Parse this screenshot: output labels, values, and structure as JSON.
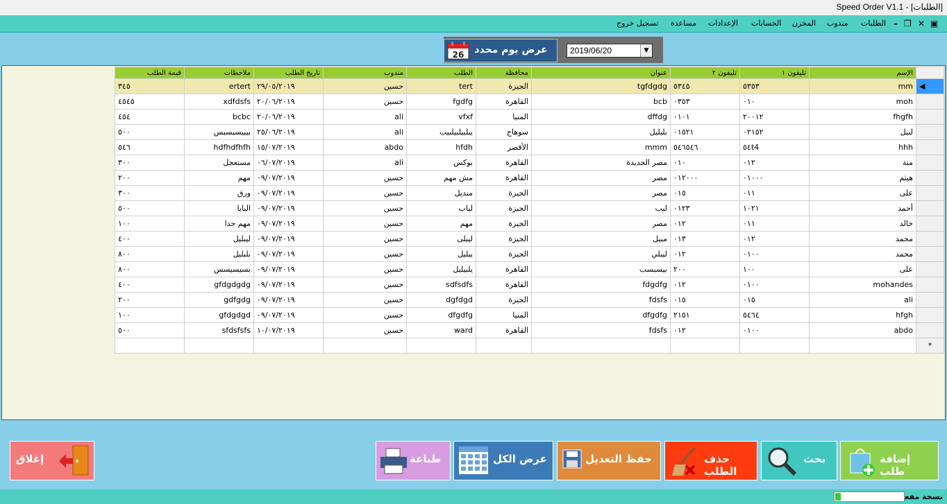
{
  "window": {
    "title": "Speed Order V1.1 - [الطلبات]"
  },
  "menu": [
    "الطلبات",
    "مندوب",
    "المخزن",
    "الحسابات",
    "الإعدادات",
    "مساعدة",
    "تسجيل خروج"
  ],
  "toolbar": {
    "show_day_label": "عرض يوم محدد",
    "calendar_badge": "26",
    "date_value": "2019/06/20"
  },
  "grid": {
    "columns": [
      "الإسم",
      "تليفون ١",
      "تليفون ٢",
      "عنوان",
      "محافظة",
      "الطلب",
      "مندوب",
      "تاريخ الطلب",
      "ملاحظات",
      "قيمة الطلب"
    ],
    "rows": [
      [
        "mm",
        "٥٣٥٣",
        "٥٣٤٥",
        "tgfdgdg",
        "الجيزة",
        "tert",
        "حسين",
        "٢٩/٠٥/٢٠١٩",
        "ertert",
        "٣٤٥"
      ],
      [
        "moh",
        "٠١٠",
        "٠٣٥٣",
        "bcb",
        "القاهرة",
        "fgdfg",
        "حسين",
        "٢٠/٠٦/٢٠١٩",
        "xdfdsfs",
        "٤٥٤٥"
      ],
      [
        "fhgfh",
        "٢٠٠١٢",
        "٠١٠١",
        "dffdg",
        "المنيا",
        "vfxf",
        "ali",
        "٢٠/٠٦/٢٠١٩",
        "bcbc",
        "٤٥٤"
      ],
      [
        "لبيل",
        "٠٢١٥٢",
        "٠١٥٢١",
        "بلبليل",
        "سوهاج",
        "يبلبيلبيلبيب",
        "ali",
        "٢٥/٠٦/٢٠١٩",
        "بيبيسبسبس",
        "٥٠٠"
      ],
      [
        "hhh",
        "٥٤t4",
        "٥٤٦٥٤٦",
        "mmm",
        "الأقصر",
        "hfdh",
        "abdo",
        "١٥/٠٧/٢٠١٩",
        "hdfhdfhfh",
        "٥٤٦"
      ],
      [
        "منة",
        "٠١٢",
        "٠١٠",
        "مصر الجديدة",
        "القاهرة",
        "بوكس",
        "ali",
        "٠٦/٠٧/٢٠١٩",
        "مستعجل",
        "٣٠٠"
      ],
      [
        "هيثم",
        "٠١٠٠٠",
        "٠١٢٠٠٠",
        "مصر",
        "القاهرة",
        "مش مهم",
        "حسين",
        "٠٩/٠٧/٢٠١٩",
        "مهم",
        "٢٠٠"
      ],
      [
        "على",
        "٠١١",
        "٠١٥",
        "مصر",
        "الجيزة",
        "منديل",
        "حسين",
        "٠٩/٠٧/٢٠١٩",
        "ورق",
        "٣٠٠"
      ],
      [
        "أحمد",
        "١٠٢١",
        "٠١٢٣",
        "لبب",
        "الجيزة",
        "لباب",
        "حسين",
        "٠٩/٠٧/٢٠١٩",
        "البابا",
        "٥٠٠"
      ],
      [
        "خالد",
        "٠١١",
        "٠١٢",
        "مصر",
        "الجيزة",
        "مهم",
        "حسين",
        "٠٩/٠٧/٢٠١٩",
        "مهم جدا",
        "١٠٠"
      ],
      [
        "محمد",
        "٠١٢",
        "٠١٣",
        "مبيل",
        "الجيزة",
        "ليبلى",
        "حسين",
        "٠٩/٠٧/٢٠١٩",
        "ليبليل",
        "٤٠٠"
      ],
      [
        "محمد",
        "٠١٠٠",
        "٠١٢",
        "ليبلي",
        "الجيزة",
        "يبليل",
        "حسين",
        "٠٩/٠٧/٢٠١٩",
        "بلبليل",
        "٨٠٠"
      ],
      [
        "على",
        "١٠٠",
        "٢٠٠",
        "بيسبسب",
        "القاهرة",
        "يلبيليل",
        "حسين",
        "٠٩/٠٧/٢٠١٩",
        "بسيسيسس",
        "٨٠٠"
      ],
      [
        "mohandes",
        "٠١٠٠",
        "٠١٢",
        "fdgdfg",
        "القاهرة",
        "sdfsdfs",
        "حسين",
        "٠٩/٠٧/٢٠١٩",
        "gfdgdgdg",
        "٤٠٠"
      ],
      [
        "ali",
        "٠١٥",
        "٠١٥",
        "fdsfs",
        "الجيزة",
        "dgfdgd",
        "حسين",
        "٠٩/٠٧/٢٠١٩",
        "gdfgdg",
        "٢٠٠"
      ],
      [
        "hfgh",
        "٥٤٦٤",
        "٢١٥١",
        "dfgdfg",
        "المنيا",
        "dfgdfg",
        "حسين",
        "٠٩/٠٧/٢٠١٩",
        "gfdgdgd",
        "١٠٠"
      ],
      [
        "abdo",
        "٠١٠٠",
        "٠١٢",
        "fdsfs",
        "القاهرة",
        "ward",
        "حسين",
        "١٠/٠٧/٢٠١٩",
        "sfdsfsfs",
        "٥٠٠"
      ]
    ],
    "new_row_marker": "*"
  },
  "buttons": {
    "add": "إضافة طلب",
    "search": "بحث",
    "delete": "حذف الطلب",
    "save": "حفظ التعديل",
    "show_all": "عرض الكل",
    "print": "طباعة",
    "close": "إغلاق"
  },
  "colors": {
    "add": "#8fd14f",
    "search": "#40c8c0",
    "delete": "#ff3b10",
    "save": "#e08a3c",
    "show_all": "#3d7ab8",
    "print": "#d89ce0",
    "close": "#f37a7a",
    "header": "#9acd32",
    "menubar": "#4ecfc2"
  },
  "status": {
    "label": "نسخة مفعلة",
    "progress": 0.08
  }
}
